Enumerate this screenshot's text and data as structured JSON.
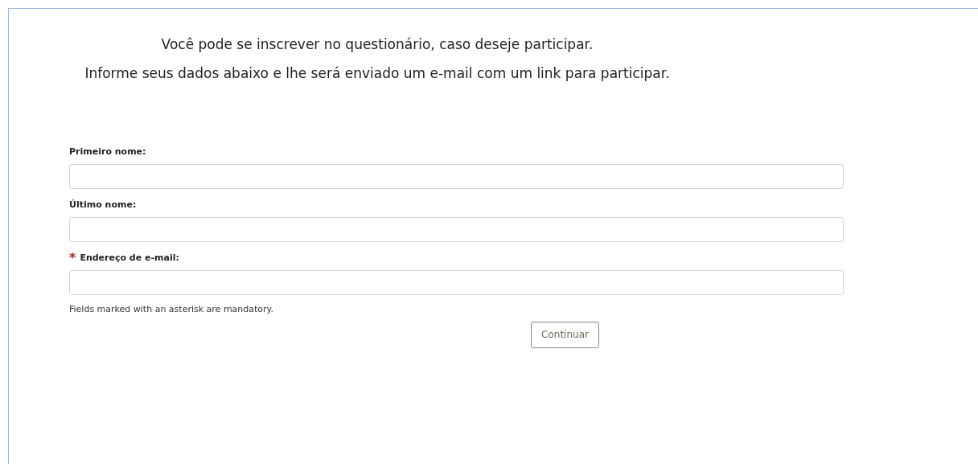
{
  "intro": [
    "Você pode se inscrever no questionário, caso deseje participar.",
    "Informe seus dados abaixo e lhe será enviado um e-mail com um link para participar."
  ],
  "required_mark": "*",
  "fields": [
    {
      "label": "Primeiro nome:",
      "required": false
    },
    {
      "label": "Último nome:",
      "required": false
    },
    {
      "label": "Endereço de e-mail:",
      "required": true
    }
  ],
  "note": "Fields marked with an asterisk are mandatory.",
  "button": "Continuar"
}
